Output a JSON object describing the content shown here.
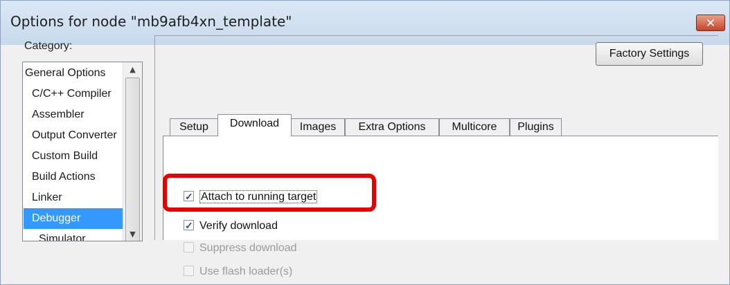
{
  "window": {
    "title": "Options for node \"mb9afb4xn_template\"",
    "close_label": "✕"
  },
  "category": {
    "label": "Category:",
    "items": [
      {
        "label": "General Options",
        "level": "root",
        "selected": false
      },
      {
        "label": "C/C++ Compiler",
        "level": "child",
        "selected": false
      },
      {
        "label": "Assembler",
        "level": "child",
        "selected": false
      },
      {
        "label": "Output Converter",
        "level": "child",
        "selected": false
      },
      {
        "label": "Custom Build",
        "level": "child",
        "selected": false
      },
      {
        "label": "Build Actions",
        "level": "child",
        "selected": false
      },
      {
        "label": "Linker",
        "level": "child",
        "selected": false
      },
      {
        "label": "Debugger",
        "level": "child",
        "selected": true
      },
      {
        "label": "Simulator",
        "level": "grandchild",
        "selected": false
      }
    ]
  },
  "factory_settings_label": "Factory Settings",
  "tabs": [
    {
      "label": "Setup",
      "active": false
    },
    {
      "label": "Download",
      "active": true
    },
    {
      "label": "Images",
      "active": false
    },
    {
      "label": "Extra Options",
      "active": false
    },
    {
      "label": "Multicore",
      "active": false
    },
    {
      "label": "Plugins",
      "active": false
    }
  ],
  "download_options": [
    {
      "label": "Attach to running target",
      "checked": true,
      "enabled": true
    },
    {
      "label": "Verify download",
      "checked": true,
      "enabled": true
    },
    {
      "label": "Suppress download",
      "checked": false,
      "enabled": false
    },
    {
      "label": "Use flash loader(s)",
      "checked": false,
      "enabled": false
    }
  ],
  "colors": {
    "highlight": "#e60000",
    "selection": "#3399ff"
  }
}
